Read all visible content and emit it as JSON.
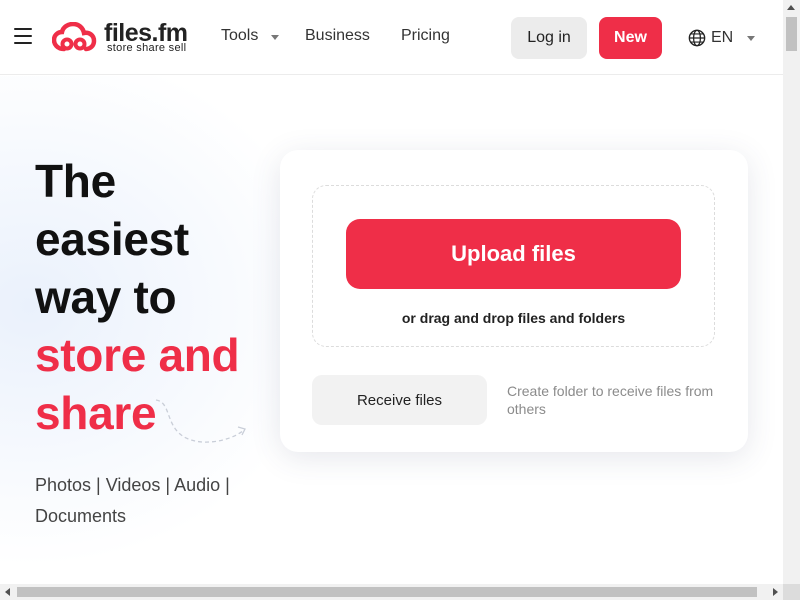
{
  "brand": {
    "name": "files.fm",
    "tagline": "store share sell",
    "accent_color": "#ef2e48"
  },
  "header": {
    "menu_icon": "hamburger-icon",
    "nav": {
      "tools": "Tools",
      "business": "Business",
      "pricing": "Pricing"
    },
    "login_label": "Log in",
    "new_label": "New",
    "language": {
      "icon": "globe-icon",
      "code": "EN"
    }
  },
  "hero": {
    "headline_lines": [
      "The",
      "easiest",
      "way to"
    ],
    "headline_accent_lines": [
      "store and",
      "share"
    ],
    "media_types": "Photos | Videos | Audio | Documents"
  },
  "upload_card": {
    "upload_label": "Upload files",
    "drag_hint": "or drag and drop files and folders",
    "receive_label": "Receive files",
    "receive_hint": "Create folder to receive files from others"
  }
}
